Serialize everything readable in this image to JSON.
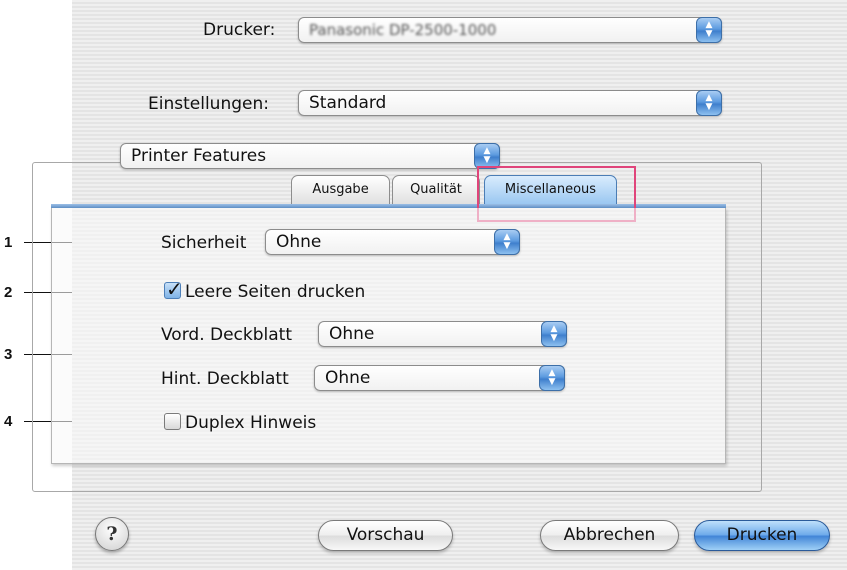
{
  "printer": {
    "label": "Drucker:",
    "value": "Panasonic DP-2500-1000"
  },
  "presets": {
    "label": "Einstellungen:",
    "value": "Standard"
  },
  "pane_selector": {
    "value": "Printer Features"
  },
  "tabs": [
    {
      "label": "Ausgabe"
    },
    {
      "label": "Qualität"
    },
    {
      "label": "Miscellaneous"
    }
  ],
  "settings": {
    "security": {
      "label": "Sicherheit",
      "value": "Ohne"
    },
    "blank_pages": {
      "label": "Leere Seiten drucken",
      "checked": true
    },
    "front_cover": {
      "label": "Vord. Deckblatt",
      "value": "Ohne"
    },
    "back_cover": {
      "label": "Hint. Deckblatt",
      "value": "Ohne"
    },
    "duplex_hint": {
      "label": "Duplex Hinweis",
      "checked": false
    }
  },
  "buttons": {
    "help": "?",
    "preview": "Vorschau",
    "cancel": "Abbrechen",
    "print": "Drucken"
  },
  "callouts": [
    "1",
    "2",
    "3",
    "4"
  ],
  "colors": {
    "highlight": "#e0457b",
    "accent_blue": "#5d9be0"
  }
}
